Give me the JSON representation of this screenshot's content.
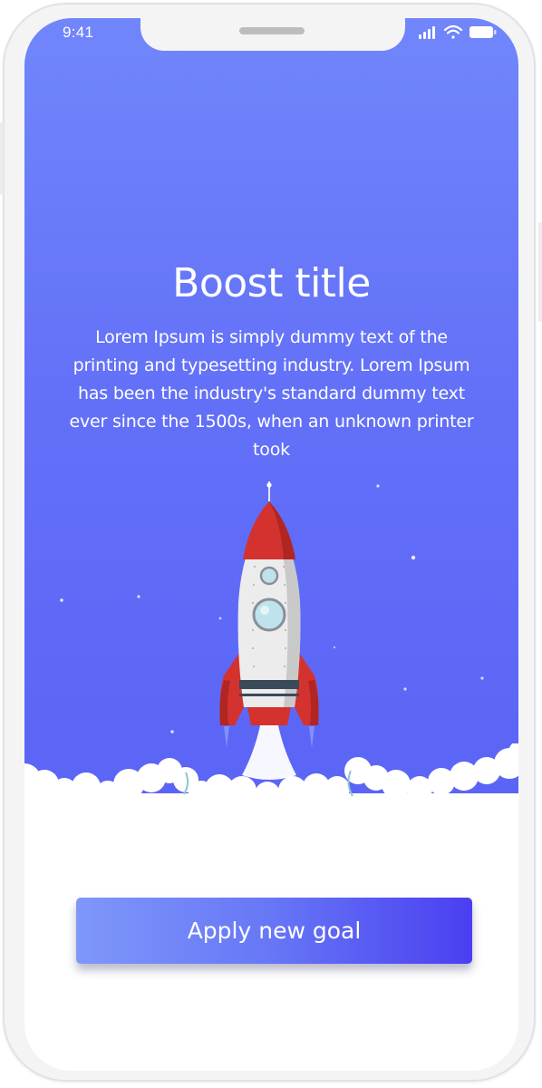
{
  "status_bar": {
    "time": "9:41",
    "icons": [
      "signal-icon",
      "wifi-icon",
      "battery-icon"
    ]
  },
  "onboarding": {
    "title": "Boost title",
    "description": "Lorem Ipsum is simply dummy text of the printing and typesetting industry. Lorem Ipsum has been the industry's standard dummy text ever since the 1500s, when an unknown printer took",
    "illustration": "rocket-launch-illustration",
    "cta_label": "Apply new goal"
  },
  "colors": {
    "hero_top": "#7186fb",
    "hero_bottom": "#5a63f6",
    "button_start": "#7f97fa",
    "button_end": "#4a3ff1",
    "rocket_red": "#d3322f",
    "rocket_body": "#ececec"
  }
}
